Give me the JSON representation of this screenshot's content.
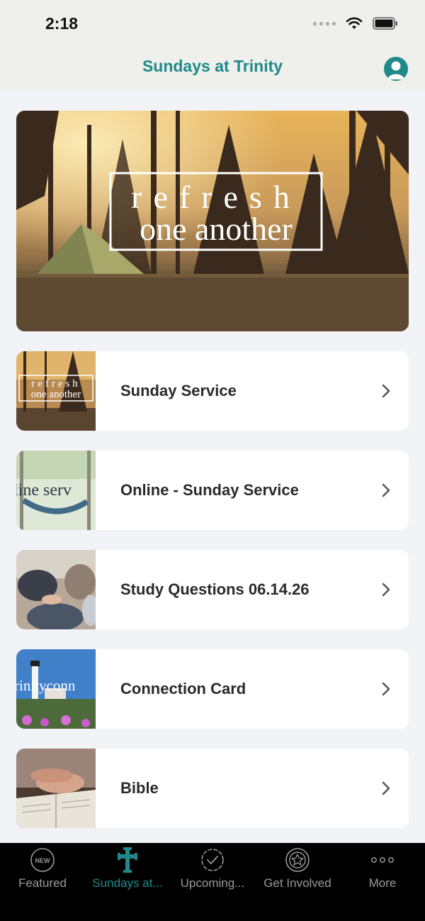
{
  "status": {
    "time": "2:18"
  },
  "header": {
    "title": "Sundays at Trinity",
    "icon": "profile-icon"
  },
  "hero": {
    "line1": "refresh",
    "line2": "one another"
  },
  "items": [
    {
      "label": "Sunday Service",
      "thumb_text": "refresh one another"
    },
    {
      "label": "Online - Sunday Service",
      "thumb_text": "line serv"
    },
    {
      "label": "Study Questions 06.14.26",
      "thumb_text": ""
    },
    {
      "label": "Connection Card",
      "thumb_text": "rinityconn"
    },
    {
      "label": "Bible",
      "thumb_text": ""
    }
  ],
  "tabs": [
    {
      "label": "Featured",
      "icon": "new-badge-icon",
      "badge": "NEW"
    },
    {
      "label": "Sundays at...",
      "icon": "cross-icon",
      "active": true
    },
    {
      "label": "Upcoming...",
      "icon": "check-seal-icon"
    },
    {
      "label": "Get Involved",
      "icon": "star-badge-icon"
    },
    {
      "label": "More",
      "icon": "more-dots-icon"
    }
  ],
  "colors": {
    "accent": "#1f8a8a",
    "tab_inactive": "#9a9a9a"
  }
}
